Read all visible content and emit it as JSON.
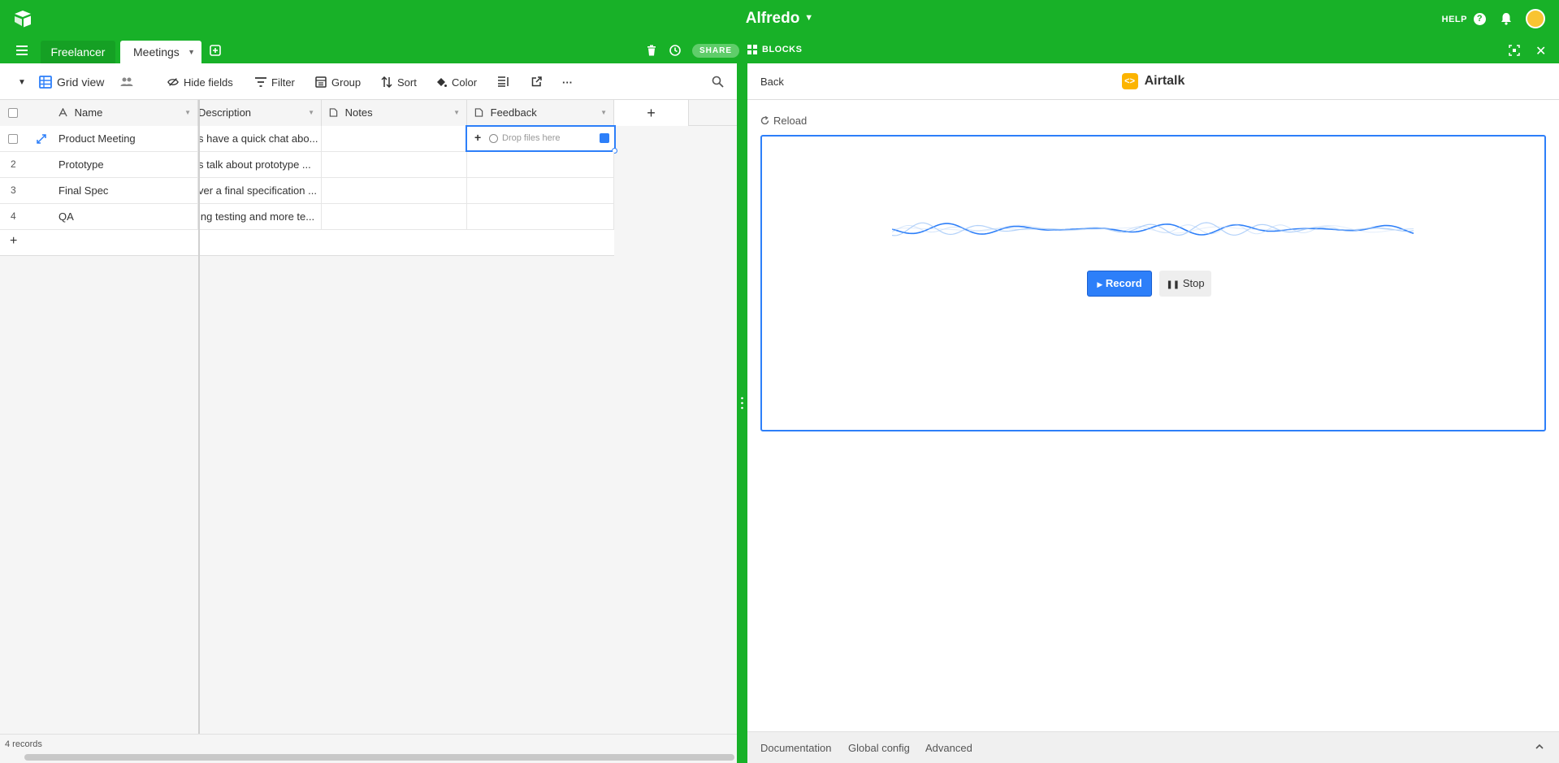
{
  "app": {
    "base_name": "Alfredo",
    "help_label": "HELP"
  },
  "tables": {
    "tabs": [
      "Freelancer",
      "Meetings"
    ],
    "share_label": "SHARE"
  },
  "blocks": {
    "label": "BLOCKS"
  },
  "view_bar": {
    "view_name": "Grid view",
    "hide_fields": "Hide fields",
    "filter": "Filter",
    "group": "Group",
    "sort": "Sort",
    "color": "Color",
    "more": "···"
  },
  "columns": {
    "name": "Name",
    "description": "Description",
    "notes": "Notes",
    "feedback": "Feedback",
    "add": "+"
  },
  "rows": [
    {
      "num": "",
      "name": "Product Meeting",
      "description": "s have a quick chat abo...",
      "notes": "",
      "feedback": ""
    },
    {
      "num": "2",
      "name": "Prototype",
      "description": "s talk about prototype ...",
      "notes": "",
      "feedback": ""
    },
    {
      "num": "3",
      "name": "Final Spec",
      "description": "ver a final specification ...",
      "notes": "",
      "feedback": ""
    },
    {
      "num": "4",
      "name": "QA",
      "description": "ing testing and more te...",
      "notes": "",
      "feedback": ""
    }
  ],
  "drop_placeholder": "Drop files here",
  "add_row": "+",
  "footer": {
    "record_count": "4 records"
  },
  "block": {
    "back": "Back",
    "title": "Airtalk",
    "logo_glyph": "<>",
    "reload": "Reload",
    "record": "Record",
    "stop": "Stop",
    "footer_links": [
      "Documentation",
      "Global config",
      "Advanced"
    ]
  },
  "colors": {
    "brand_green": "#18b128",
    "accent_blue": "#2d7ff9",
    "block_yellow": "#fcb400"
  },
  "icons": [
    "airtable-logo-icon",
    "caret-down-icon",
    "help-icon",
    "bell-icon",
    "avatar",
    "menu-icon",
    "add-table-icon",
    "trash-icon",
    "history-icon",
    "blocks-icon",
    "fullscreen-icon",
    "close-icon",
    "grid-view-icon",
    "people-icon",
    "hide-fields-icon",
    "filter-icon",
    "group-icon",
    "sort-icon",
    "color-icon",
    "row-height-icon",
    "share-view-icon",
    "more-icon",
    "search-icon",
    "text-field-icon",
    "long-text-icon",
    "attachment-icon",
    "expand-record-icon",
    "reload-icon",
    "chevron-up-icon"
  ]
}
